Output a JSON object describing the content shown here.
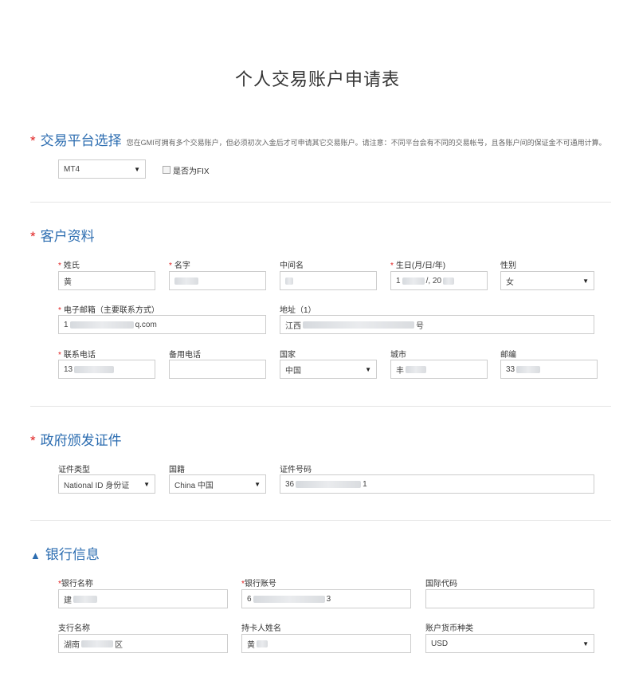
{
  "page_title": "个人交易账户申请表",
  "platform": {
    "heading": "交易平台选择",
    "note": "您在GMI可拥有多个交易账户，但必须初次入金后才可申请其它交易账户。请注意：不同平台会有不同的交易帐号，且各账户间的保证金不可通用计算。",
    "select_value": "MT4",
    "fix_label": "是否为FIX"
  },
  "customer": {
    "heading": "客户资料",
    "last_name_label": "姓氏",
    "last_name_value": "黄",
    "first_name_label": "名字",
    "first_name_value": "",
    "middle_name_label": "中间名",
    "middle_name_value": "",
    "birthday_label": "生日(月/日/年)",
    "birthday_prefix": "1",
    "birthday_suffix": "/, 20",
    "gender_label": "性别",
    "gender_value": "女",
    "email_label": "电子邮箱（主要联系方式）",
    "email_prefix": "1",
    "email_suffix": "q.com",
    "address_label": "地址（1）",
    "address_prefix": "江西",
    "address_suffix": "号",
    "phone_label": "联系电话",
    "phone_prefix": "13",
    "alt_phone_label": "备用电话",
    "alt_phone_value": "",
    "country_label": "国家",
    "country_value": "中国",
    "city_label": "城市",
    "city_prefix": "丰",
    "zip_label": "邮编",
    "zip_prefix": "33"
  },
  "government_id": {
    "heading": "政府颁发证件",
    "type_label": "证件类型",
    "type_value": "National ID 身份证",
    "nationality_label": "国籍",
    "nationality_value": "China 中国",
    "number_label": "证件号码",
    "number_prefix": "36",
    "number_suffix": "1"
  },
  "bank": {
    "heading": "银行信息",
    "bank_name_label": "银行名称",
    "bank_name_prefix": "建",
    "account_label": "银行账号",
    "account_prefix": "6",
    "account_suffix": "3",
    "intl_code_label": "国际代码",
    "intl_code_value": "",
    "branch_label": "支行名称",
    "branch_prefix": "湖南",
    "branch_suffix": "区",
    "holder_label": "持卡人姓名",
    "holder_prefix": "黄",
    "currency_label": "账户货币种类",
    "currency_value": "USD"
  }
}
